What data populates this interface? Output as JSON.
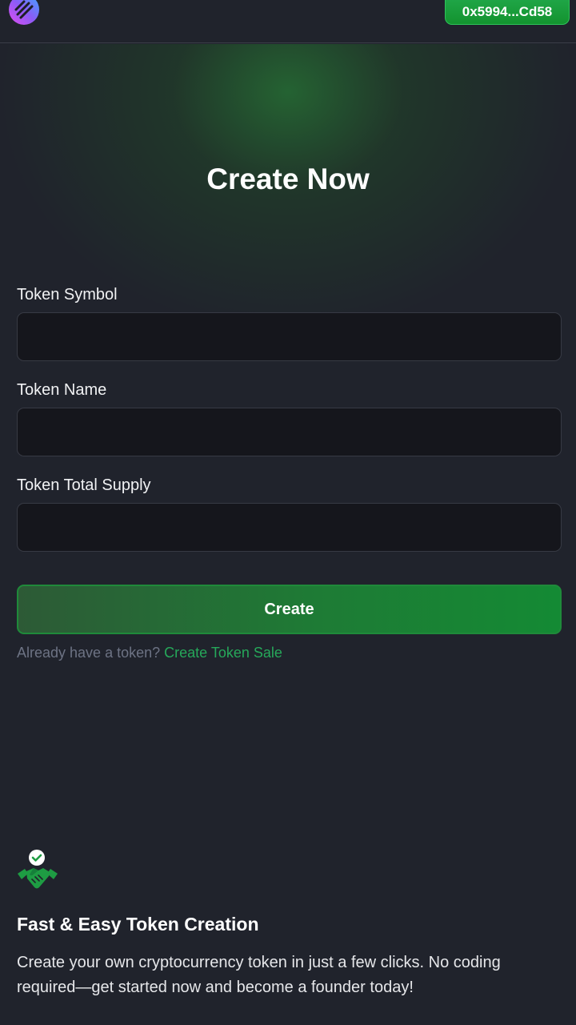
{
  "header": {
    "logo_icon": "app-logo-icon",
    "wallet_address": "0x5994...Cd58"
  },
  "main": {
    "title": "Create Now",
    "fields": [
      {
        "label": "Token Symbol",
        "value": "",
        "placeholder": ""
      },
      {
        "label": "Token Name",
        "value": "",
        "placeholder": ""
      },
      {
        "label": "Token Total Supply",
        "value": "",
        "placeholder": ""
      }
    ],
    "create_button": "Create",
    "already_text": "Already have a token?",
    "create_sale_link": "Create Token Sale"
  },
  "feature": {
    "icon": "handshake-check-icon",
    "title": "Fast & Easy Token Creation",
    "description": "Create your own cryptocurrency token in just a few clicks. No coding required—get started now and become a founder today!"
  },
  "colors": {
    "background": "#20232c",
    "accent_green": "#1e9c43",
    "link_green": "#26a85a",
    "input_bg": "#15161c"
  }
}
